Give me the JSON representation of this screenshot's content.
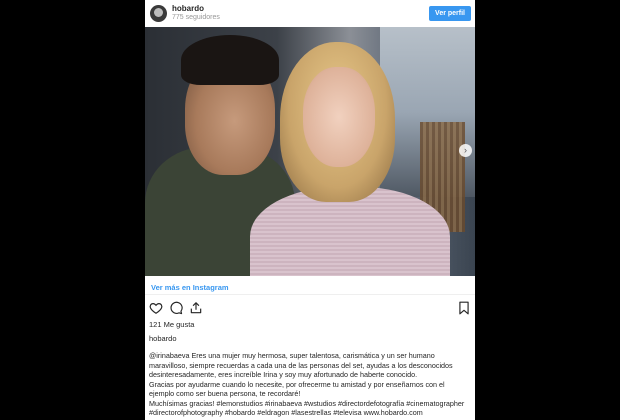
{
  "header": {
    "username": "hobardo",
    "followers": "775 seguidores",
    "view_profile": "Ver perfil"
  },
  "post": {
    "view_more": "Ver más en Instagram",
    "likes": "121 Me gusta",
    "author": "hobardo",
    "caption_lines": [
      "@irinabaeva Eres una mujer muy hermosa, super talentosa, carismática y un ser humano",
      "maravilloso, siempre recuerdas a cada una de las personas del set, ayudas a los desconocidos",
      "desinteresadamente, eres increíble Irina y soy muy afortunado de haberte conocido.",
      "Gracias por ayudarme cuando lo necesite, por ofrecerme tu amistad y por enseñarnos con el",
      "ejemplo como ser buena persona, te recordaré!",
      "Muchísimas gracias! #lemonstudios #irinabaeva #wstudios #directordefotografía #cinematographer",
      "#directorofphotography #hobardo #eldragon #lasestrellas #televisa www.hobardo.com"
    ]
  },
  "icons": {
    "like": "heart-icon",
    "comment": "comment-icon",
    "share": "upload-icon",
    "save": "bookmark-icon",
    "next": "chevron-right-icon"
  },
  "colors": {
    "accent": "#3897f0",
    "background": "#000000",
    "text": "#262626"
  }
}
